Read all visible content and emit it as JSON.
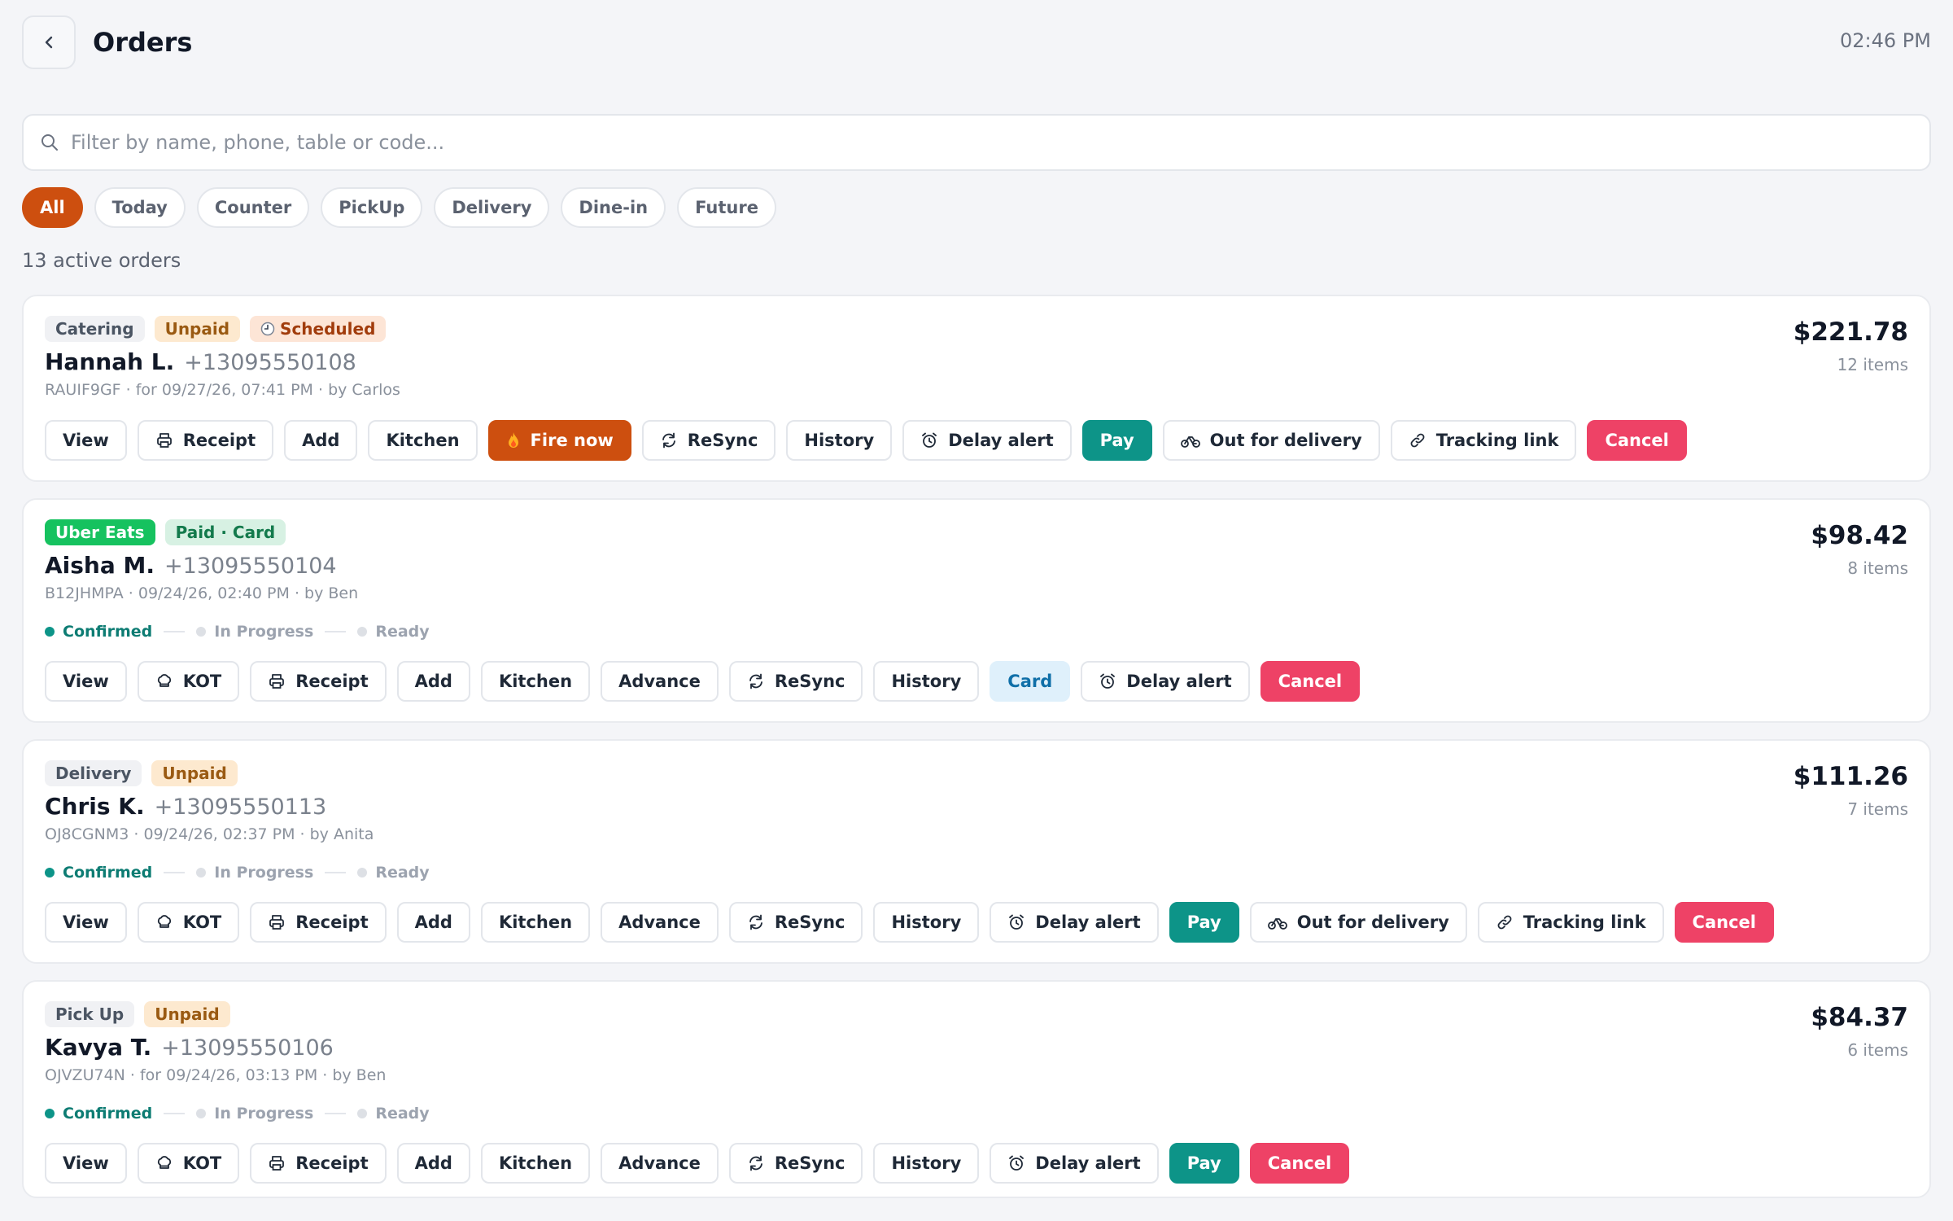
{
  "header": {
    "title": "Orders",
    "time": "02:46 PM"
  },
  "search": {
    "placeholder": "Filter by name, phone, table or code..."
  },
  "filters": [
    "All",
    "Today",
    "Counter",
    "PickUp",
    "Delivery",
    "Dine-in",
    "Future"
  ],
  "active_filter": "All",
  "order_count": "13 active orders",
  "colors": {
    "accent": "#cd4f0f",
    "pay": "#0d9488",
    "cancel": "#ee4266",
    "uber_eats": "#16c25f"
  },
  "progress_labels": {
    "confirmed": "Confirmed",
    "in_progress": "In Progress",
    "ready": "Ready"
  },
  "buttons": {
    "view": "View",
    "kot": "KOT",
    "receipt": "Receipt",
    "add": "Add",
    "kitchen": "Kitchen",
    "fire_now": "Fire now",
    "advance": "Advance",
    "resync": "ReSync",
    "history": "History",
    "delay_alert": "Delay alert",
    "pay": "Pay",
    "card": "Card",
    "out_for_delivery": "Out for delivery",
    "tracking_link": "Tracking link",
    "cancel": "Cancel"
  },
  "icons": {
    "back": "chevron-left-icon",
    "search": "search-icon",
    "receipt": "printer-icon",
    "kot": "chef-hat-icon",
    "fire": "fire-icon",
    "resync": "refresh-icon",
    "delay": "alarm-clock-icon",
    "delivery": "bike-icon",
    "tracking": "link-icon",
    "scheduled": "clock-icon"
  },
  "orders": [
    {
      "tags": [
        "Catering",
        "Unpaid",
        "Scheduled"
      ],
      "name": "Hannah L.",
      "phone": "+13095550108",
      "meta": "RAUIF9GF · for 09/27/26, 07:41 PM · by Carlos",
      "total": "$221.78",
      "items": "12 items"
    },
    {
      "tags": [
        "Uber Eats",
        "Paid · Card"
      ],
      "name": "Aisha M.",
      "phone": "+13095550104",
      "meta": "B12JHMPA · 09/24/26, 02:40 PM · by Ben",
      "total": "$98.42",
      "items": "8 items"
    },
    {
      "tags": [
        "Delivery",
        "Unpaid"
      ],
      "name": "Chris K.",
      "phone": "+13095550113",
      "meta": "OJ8CGNM3 · 09/24/26, 02:37 PM · by Anita",
      "total": "$111.26",
      "items": "7 items"
    },
    {
      "tags": [
        "Pick Up",
        "Unpaid"
      ],
      "name": "Kavya T.",
      "phone": "+13095550106",
      "meta": "OJVZU74N · for 09/24/26, 03:13 PM · by Ben",
      "total": "$84.37",
      "items": "6 items"
    }
  ]
}
